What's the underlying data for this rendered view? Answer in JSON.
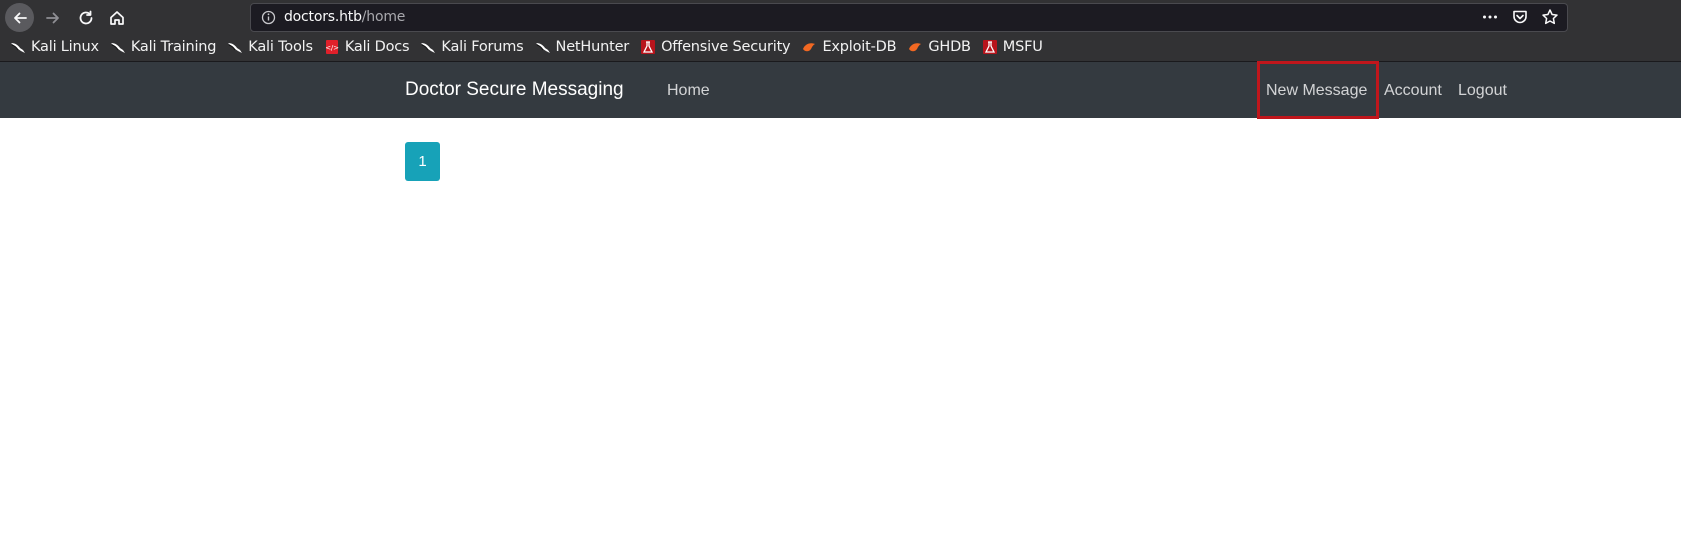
{
  "browser": {
    "url_host": "doctors.htb",
    "url_path": "/home",
    "icons": {
      "back": "back-arrow-icon",
      "forward": "forward-arrow-icon",
      "reload": "reload-icon",
      "home": "home-icon",
      "info": "info-icon",
      "more": "more-dots-icon",
      "pocket": "pocket-icon",
      "bookmark": "star-icon"
    },
    "bookmarks": [
      {
        "label": "Kali Linux",
        "icon": "kali-dragon-icon"
      },
      {
        "label": "Kali Training",
        "icon": "kali-dragon-icon"
      },
      {
        "label": "Kali Tools",
        "icon": "kali-dragon-icon"
      },
      {
        "label": "Kali Docs",
        "icon": "kali-docs-icon"
      },
      {
        "label": "Kali Forums",
        "icon": "kali-dragon-icon"
      },
      {
        "label": "NetHunter",
        "icon": "kali-dragon-icon"
      },
      {
        "label": "Offensive Security",
        "icon": "offsec-icon"
      },
      {
        "label": "Exploit-DB",
        "icon": "exploitdb-icon"
      },
      {
        "label": "GHDB",
        "icon": "exploitdb-icon"
      },
      {
        "label": "MSFU",
        "icon": "offsec-icon"
      }
    ]
  },
  "navbar": {
    "brand": "Doctor Secure Messaging",
    "home": "Home",
    "new_message": "New Message",
    "account": "Account",
    "logout": "Logout"
  },
  "pagination": {
    "current_page": "1"
  },
  "colors": {
    "navbar_bg": "#343a40",
    "page_button": "#17a2b8",
    "highlight": "#c0161c"
  }
}
